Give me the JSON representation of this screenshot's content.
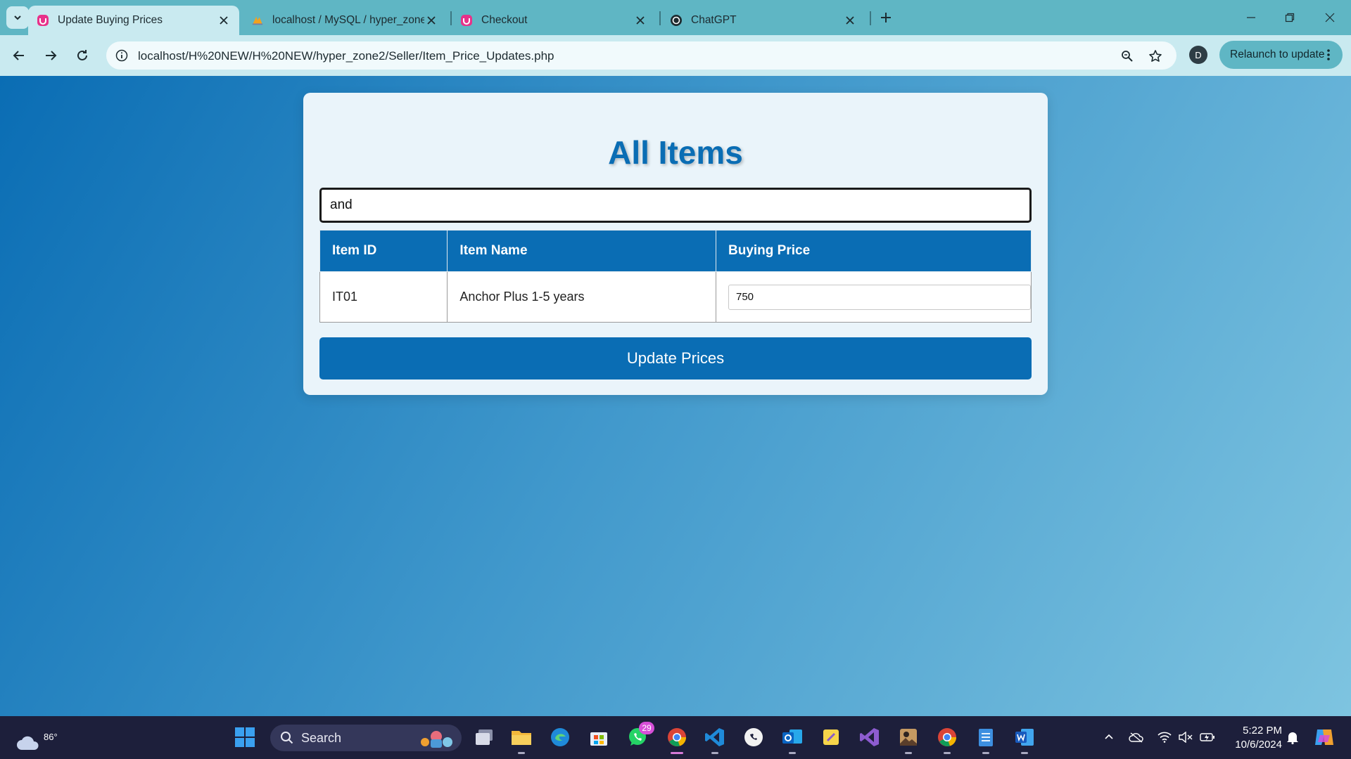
{
  "browser": {
    "tabs": [
      {
        "title": "Update Buying Prices",
        "active": true
      },
      {
        "title": "localhost / MySQL / hyper_zone",
        "active": false
      },
      {
        "title": "Checkout",
        "active": false
      },
      {
        "title": "ChatGPT",
        "active": false
      }
    ],
    "url": "localhost/H%20NEW/H%20NEW/hyper_zone2/Seller/Item_Price_Updates.php",
    "profile_initial": "D",
    "relaunch_label": "Relaunch to update"
  },
  "page": {
    "title": "All Items",
    "search_value": "and",
    "table": {
      "headers": [
        "Item ID",
        "Item Name",
        "Buying Price"
      ],
      "rows": [
        {
          "item_id": "IT01",
          "item_name": "Anchor Plus 1-5 years",
          "buying_price": "750"
        }
      ]
    },
    "update_button_label": "Update Prices"
  },
  "taskbar": {
    "weather_temp": "86°",
    "search_label": "Search",
    "whatsapp_badge": "29",
    "clock_time": "5:22 PM",
    "clock_date": "10/6/2024"
  },
  "colors": {
    "tab_bar": "#5fb6c4",
    "toolbar": "#c9eaf0",
    "accent_blue": "#0a6db4",
    "card_bg": "#eaf4fa",
    "taskbar": "#1d1f3b"
  }
}
